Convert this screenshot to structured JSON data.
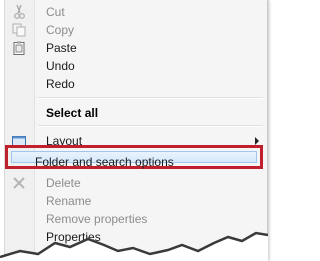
{
  "context_menu": {
    "items": [
      {
        "label": "Cut",
        "icon": "cut-icon",
        "disabled": true
      },
      {
        "label": "Copy",
        "icon": "copy-icon",
        "disabled": true
      },
      {
        "label": "Paste",
        "icon": "paste-icon",
        "disabled": false
      },
      {
        "label": "Undo",
        "disabled": false
      },
      {
        "label": "Redo",
        "disabled": false
      },
      {
        "label": "Select all",
        "disabled": false
      },
      {
        "label": "Layout",
        "icon": "layout-icon",
        "submenu": true
      },
      {
        "label": "Folder and search options",
        "highlighted": true
      },
      {
        "label": "Delete",
        "icon": "delete-icon",
        "disabled": true
      },
      {
        "label": "Rename",
        "disabled": true
      },
      {
        "label": "Remove properties",
        "disabled": true
      },
      {
        "label": "Properties",
        "disabled": false
      }
    ]
  },
  "colors": {
    "highlight_border": "#c0202e",
    "menu_background": "#f5f5f5"
  }
}
